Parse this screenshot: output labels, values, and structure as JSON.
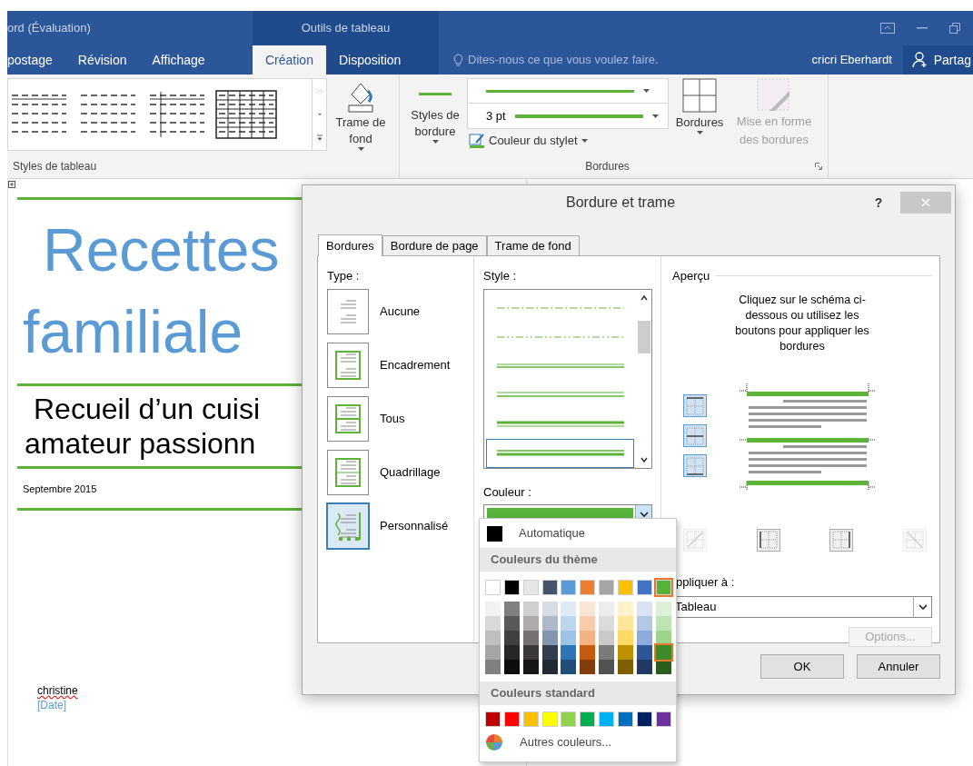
{
  "title_bar": {
    "title": "ord (Évaluation)",
    "context": "Outils de tableau"
  },
  "ribbon_tabs": [
    {
      "label": "postage",
      "kind": "normal",
      "selected": false
    },
    {
      "label": "Révision",
      "kind": "normal",
      "selected": false
    },
    {
      "label": "Affichage",
      "kind": "normal",
      "selected": false
    },
    {
      "label": "Création",
      "kind": "contextual",
      "selected": true
    },
    {
      "label": "Disposition",
      "kind": "contextual",
      "selected": false
    }
  ],
  "tell_me": {
    "placeholder": "Dites-nous ce que vous voulez faire."
  },
  "user": "cricri Eberhardt",
  "share": "Partag",
  "ribbon": {
    "shading": "Trame de fond",
    "border_styles": "Styles de bordure",
    "weight": "3 pt",
    "pen_color": "Couleur du stylet",
    "borders": "Bordures",
    "border_painter": {
      "label": "Mise en forme des bordures",
      "disabled": true
    },
    "table_styles_group": "Styles de tableau",
    "borders_group": "Bordures"
  },
  "document": {
    "title_lines": [
      "Recettes",
      "familiale"
    ],
    "subtitle_lines": [
      "Recueil d’un cuisi",
      "amateur passionn"
    ],
    "date": "Septembre 2015",
    "author": {
      "text": "christine",
      "misspelled": true
    },
    "date_placeholder": "[Date]"
  },
  "dialog": {
    "title": "Bordure et trame",
    "help": "?",
    "tabs": [
      {
        "label": "Bordures",
        "selected": true
      },
      {
        "label": "Bordure de page",
        "selected": false
      },
      {
        "label": "Trame de fond",
        "selected": false
      }
    ],
    "type_label": "Type :",
    "types": [
      {
        "label": "Aucune",
        "kind": "none",
        "selected": false
      },
      {
        "label": "Encadrement",
        "kind": "box",
        "selected": false
      },
      {
        "label": "Tous",
        "kind": "all",
        "selected": false
      },
      {
        "label": "Quadrillage",
        "kind": "grid",
        "selected": false
      },
      {
        "label": "Personnalisé",
        "kind": "custom",
        "selected": true
      }
    ],
    "style_label": "Style :",
    "styles": [
      {
        "kind": "dash-dot",
        "selected": false
      },
      {
        "kind": "dash-dot-dot",
        "selected": false
      },
      {
        "kind": "double",
        "selected": false
      },
      {
        "kind": "double-wide",
        "selected": false
      },
      {
        "kind": "thick-thin",
        "selected": false
      },
      {
        "kind": "thick",
        "selected": true
      }
    ],
    "color_label": "Couleur :",
    "color": "#56b33a",
    "preview_label": "Aperçu",
    "preview_hint": "Cliquez sur le schéma ci-dessous ou utilisez les boutons pour appliquer les bordures",
    "side_buttons": [
      {
        "kind": "top",
        "on": true
      },
      {
        "kind": "middle",
        "on": true
      },
      {
        "kind": "bottom",
        "on": true
      }
    ],
    "bottom_buttons": [
      {
        "kind": "diagonal-up",
        "on": false,
        "disabled": true
      },
      {
        "kind": "left",
        "on": false,
        "disabled": false
      },
      {
        "kind": "right",
        "on": false,
        "disabled": false
      },
      {
        "kind": "diagonal-down",
        "on": false,
        "disabled": true
      }
    ],
    "apply_label": "ppliquer à :",
    "apply_value": "Tableau",
    "options": {
      "label": "Options...",
      "disabled": true
    },
    "buttons": [
      "OK",
      "Annuler"
    ]
  },
  "color_menu": {
    "automatic": "Automatique",
    "theme_heading": "Couleurs du thème",
    "theme": [
      {
        "color": "#ffffff",
        "selected": false
      },
      {
        "color": "#000000",
        "selected": false
      },
      {
        "color": "#e7e6e6",
        "selected": false
      },
      {
        "color": "#44546a",
        "selected": false
      },
      {
        "color": "#5b9bd5",
        "selected": false
      },
      {
        "color": "#ed7d31",
        "selected": false
      },
      {
        "color": "#a5a5a5",
        "selected": false
      },
      {
        "color": "#ffc000",
        "selected": false
      },
      {
        "color": "#4472c4",
        "selected": false
      },
      {
        "color": "#56b33a",
        "selected": true
      }
    ],
    "shades": [
      [
        {
          "color": "#f2f2f2",
          "selected": false
        },
        {
          "color": "#d9d9d9",
          "selected": false
        },
        {
          "color": "#bfbfbf",
          "selected": false
        },
        {
          "color": "#a6a6a6",
          "selected": false
        },
        {
          "color": "#808080",
          "selected": false
        }
      ],
      [
        {
          "color": "#808080",
          "selected": false
        },
        {
          "color": "#595959",
          "selected": false
        },
        {
          "color": "#404040",
          "selected": false
        },
        {
          "color": "#262626",
          "selected": false
        },
        {
          "color": "#0d0d0d",
          "selected": false
        }
      ],
      [
        {
          "color": "#d0cece",
          "selected": false
        },
        {
          "color": "#aeaaaa",
          "selected": false
        },
        {
          "color": "#757171",
          "selected": false
        },
        {
          "color": "#3a3838",
          "selected": false
        },
        {
          "color": "#161616",
          "selected": false
        }
      ],
      [
        {
          "color": "#d6dce5",
          "selected": false
        },
        {
          "color": "#adb9ca",
          "selected": false
        },
        {
          "color": "#8497b0",
          "selected": false
        },
        {
          "color": "#333f50",
          "selected": false
        },
        {
          "color": "#222a35",
          "selected": false
        }
      ],
      [
        {
          "color": "#deebf7",
          "selected": false
        },
        {
          "color": "#bdd7ee",
          "selected": false
        },
        {
          "color": "#9dc3e6",
          "selected": false
        },
        {
          "color": "#2e75b6",
          "selected": false
        },
        {
          "color": "#1f4e79",
          "selected": false
        }
      ],
      [
        {
          "color": "#fbe5d6",
          "selected": false
        },
        {
          "color": "#f8cbad",
          "selected": false
        },
        {
          "color": "#f4b183",
          "selected": false
        },
        {
          "color": "#c55a11",
          "selected": false
        },
        {
          "color": "#843c0c",
          "selected": false
        }
      ],
      [
        {
          "color": "#ededed",
          "selected": false
        },
        {
          "color": "#dbdbdb",
          "selected": false
        },
        {
          "color": "#c9c9c9",
          "selected": false
        },
        {
          "color": "#7b7b7b",
          "selected": false
        },
        {
          "color": "#525252",
          "selected": false
        }
      ],
      [
        {
          "color": "#fff2cc",
          "selected": false
        },
        {
          "color": "#ffe699",
          "selected": false
        },
        {
          "color": "#ffd966",
          "selected": false
        },
        {
          "color": "#bf9000",
          "selected": false
        },
        {
          "color": "#7f6000",
          "selected": false
        }
      ],
      [
        {
          "color": "#dae3f3",
          "selected": false
        },
        {
          "color": "#b4c7e7",
          "selected": false
        },
        {
          "color": "#8faadc",
          "selected": false
        },
        {
          "color": "#2f5597",
          "selected": false
        },
        {
          "color": "#203864",
          "selected": false
        }
      ],
      [
        {
          "color": "#dff0d8",
          "selected": false
        },
        {
          "color": "#bfe3b2",
          "selected": false
        },
        {
          "color": "#9fd48b",
          "selected": false
        },
        {
          "color": "#3f8a28",
          "selected": true
        },
        {
          "color": "#2a5c1b",
          "selected": false
        }
      ]
    ],
    "standard_heading": "Couleurs standard",
    "standard": [
      {
        "color": "#c00000",
        "selected": false
      },
      {
        "color": "#ff0000",
        "selected": false
      },
      {
        "color": "#ffc000",
        "selected": false
      },
      {
        "color": "#ffff00",
        "selected": false
      },
      {
        "color": "#92d050",
        "selected": false
      },
      {
        "color": "#00b050",
        "selected": false
      },
      {
        "color": "#00b0f0",
        "selected": false
      },
      {
        "color": "#0070c0",
        "selected": false
      },
      {
        "color": "#002060",
        "selected": false
      },
      {
        "color": "#7030a0",
        "selected": false
      }
    ],
    "more": "Autres couleurs..."
  }
}
